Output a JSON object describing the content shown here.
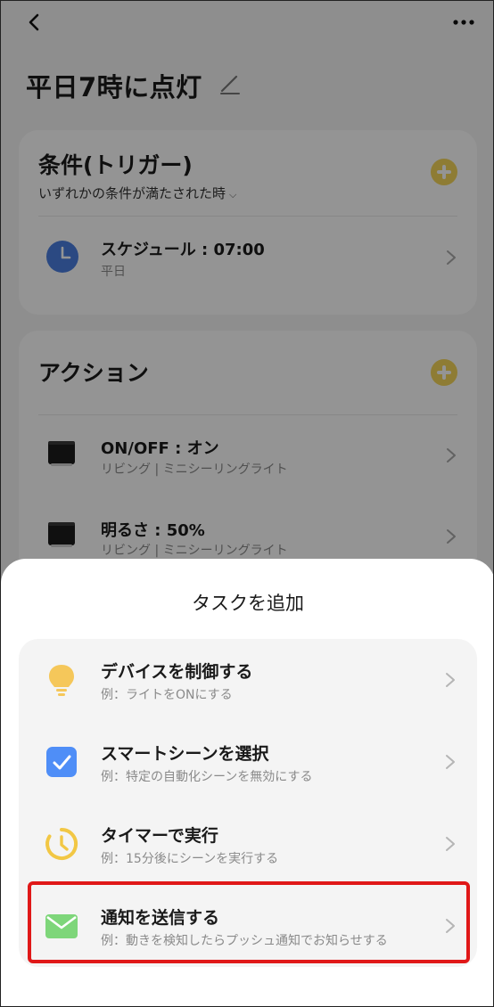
{
  "page": {
    "title": "平日7時に点灯"
  },
  "trigger": {
    "heading": "条件(トリガー)",
    "condition_mode": "いずれかの条件が満たされた時",
    "items": [
      {
        "title": "スケジュール : 07:00",
        "subtitle": "平日",
        "icon": "clock-icon"
      }
    ]
  },
  "action": {
    "heading": "アクション",
    "items": [
      {
        "title": "ON/OFF : オン",
        "subtitle": "リビング | ミニシーリングライト",
        "icon": "lamp-icon"
      },
      {
        "title": "明るさ : 50%",
        "subtitle": "リビング | ミニシーリングライト",
        "icon": "lamp-icon"
      }
    ]
  },
  "sheet": {
    "title": "タスクを追加",
    "tasks": [
      {
        "title": "デバイスを制御する",
        "subtitle": "例：ライトをONにする",
        "icon": "lightbulb-icon"
      },
      {
        "title": "スマートシーンを選択",
        "subtitle": "例：特定の自動化シーンを無効にする",
        "icon": "checkbox-icon"
      },
      {
        "title": "タイマーで実行",
        "subtitle": "例：15分後にシーンを実行する",
        "icon": "timer-icon"
      },
      {
        "title": "通知を送信する",
        "subtitle": "例：動きを検知したらプッシュ通知でお知らせする",
        "icon": "envelope-icon"
      }
    ],
    "highlighted_task": "通知を送信する"
  },
  "colors": {
    "accent_yellow": "#f5d65a",
    "clock_blue": "#4a7fe0",
    "check_blue": "#4f8ef7",
    "timer_yellow": "#f2c744",
    "envelope_green": "#7ed67a",
    "highlight_red": "#e01818"
  }
}
